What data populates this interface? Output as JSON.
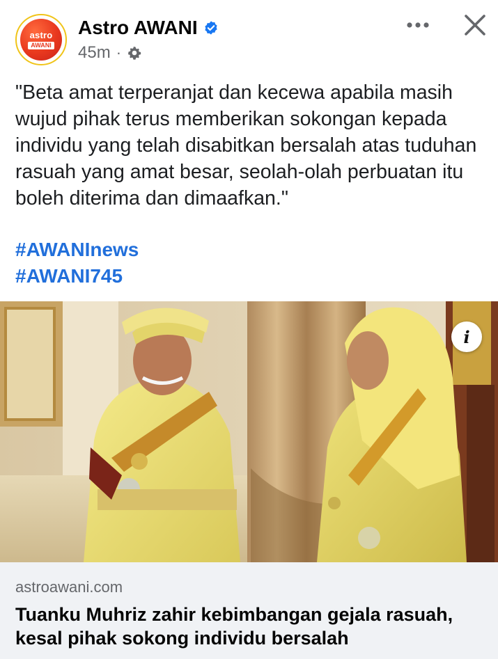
{
  "post": {
    "page_name": "Astro AWANI",
    "verified": true,
    "timestamp": "45m",
    "separator": "·",
    "privacy_icon": "gear-icon",
    "avatar": {
      "top_text": "astro",
      "bottom_text": "AWANI"
    },
    "more_icon": "more-horizontal-icon",
    "close_icon": "close-icon",
    "body_text": "\"Beta amat terperanjat dan kecewa apabila masih wujud pihak terus memberikan sokongan kepada individu yang telah disabitkan bersalah atas tuduhan rasuah yang amat besar, seolah-olah perbuatan itu boleh diterima dan dimaafkan.\"",
    "hashtags": [
      "#AWANInews",
      "#AWANI745"
    ],
    "info_label": "i"
  },
  "link_preview": {
    "domain": "astroawani.com",
    "title": "Tuanku Muhriz zahir kebimbangan gejala rasuah, kesal pihak sokong individu bersalah"
  },
  "colors": {
    "link_blue": "#216fdb",
    "verified_blue": "#1877f2",
    "meta_gray": "#65676b",
    "preview_bg": "#f0f2f5",
    "brand_red": "#e8381e"
  }
}
